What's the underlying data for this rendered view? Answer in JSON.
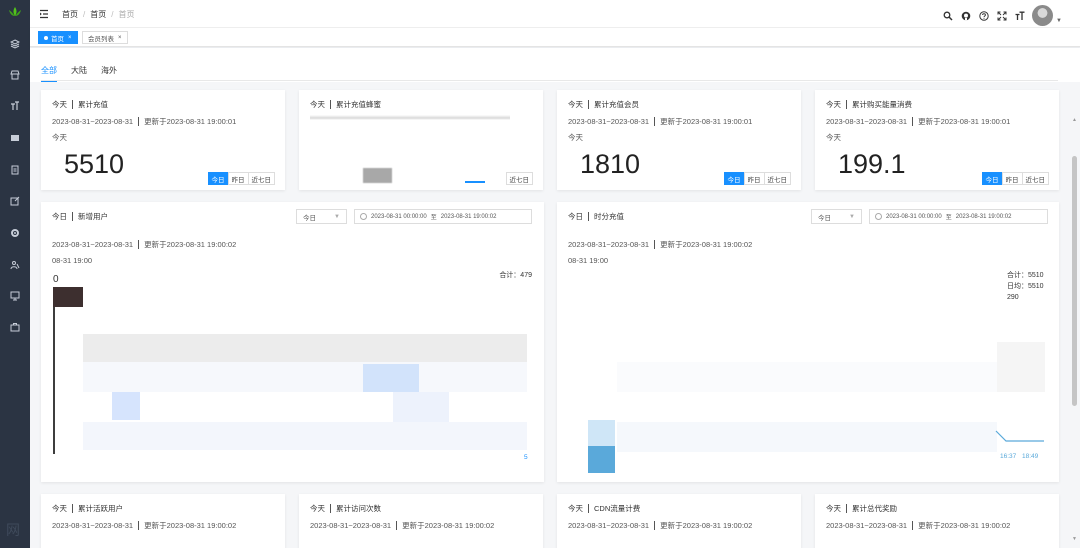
{
  "colors": {
    "primary": "#1890ff",
    "sidebar": "#2b3443"
  },
  "sidebar": {
    "icons": [
      "lotus-logo-icon",
      "layers-icon",
      "shop-icon",
      "text-size-icon",
      "grid-icon",
      "document-icon",
      "edit-icon",
      "gear-icon",
      "users-icon",
      "monitor-icon",
      "briefcase-icon"
    ],
    "bottom_glyph": "网"
  },
  "header": {
    "breadcrumb": [
      "首页",
      "首页",
      "首页"
    ],
    "tools": [
      "search-icon",
      "github-icon",
      "question-icon",
      "fullscreen-icon",
      "font-size-icon"
    ]
  },
  "tags": {
    "active": "首页",
    "second": "会员列表"
  },
  "tabs": [
    "全部",
    "大陆",
    "海外"
  ],
  "segments": [
    "今日",
    "昨日",
    "近七日"
  ],
  "cards_top": [
    {
      "period": "今天",
      "title": "累计充值",
      "range": "2023-08-31~2023-08-31",
      "updated": "更新于2023-08-31 19:00:01",
      "label": "今天",
      "value": "5510"
    },
    {
      "period": "今天",
      "title": "累计充值蜂蜜",
      "range": "",
      "updated": "",
      "label": "",
      "value": "",
      "seg": "近七日"
    },
    {
      "period": "今天",
      "title": "累计充值会员",
      "range": "2023-08-31~2023-08-31",
      "updated": "更新于2023-08-31 19:00:01",
      "label": "今天",
      "value": "1810"
    },
    {
      "period": "今天",
      "title": "累计购买能量消费",
      "range": "2023-08-31~2023-08-31",
      "updated": "更新于2023-08-31 19:00:01",
      "label": "今天",
      "value": "199.1"
    }
  ],
  "chart_left": {
    "period": "今日",
    "title": "新增用户",
    "select": "今日",
    "range_start": "2023-08-31 00:00:00",
    "range_sep": "至",
    "range_end": "2023-08-31 19:00:02",
    "date_range": "2023-08-31~2023-08-31",
    "updated": "更新于2023-08-31 19:00:02",
    "time": "08-31 19:00",
    "sum": "合计：479",
    "axis_top": "0",
    "axis_bottom": "5"
  },
  "chart_right": {
    "period": "今日",
    "title": "时分充值",
    "select": "今日",
    "range_start": "2023-08-31 00:00:00",
    "range_sep": "至",
    "range_end": "2023-08-31 19:00:02",
    "date_range": "2023-08-31~2023-08-31",
    "updated": "更新于2023-08-31 19:00:02",
    "time": "08-31 19:00",
    "sum": "合计：5510",
    "avg": "日均：5510",
    "extra": "290",
    "x_ticks": [
      "16:37",
      "18:49"
    ]
  },
  "cards_bottom": [
    {
      "period": "今天",
      "title": "累计活跃用户",
      "range": "2023-08-31~2023-08-31",
      "updated": "更新于2023-08-31 19:00:02"
    },
    {
      "period": "今天",
      "title": "累计访问次数",
      "range": "2023-08-31~2023-08-31",
      "updated": "更新于2023-08-31 19:00:02"
    },
    {
      "period": "今天",
      "title": "CDN流量计费",
      "range": "2023-08-31~2023-08-31",
      "updated": "更新于2023-08-31 19:00:02"
    },
    {
      "period": "今天",
      "title": "累计总代奖励",
      "range": "2023-08-31~2023-08-31",
      "updated": "更新于2023-08-31 19:00:02"
    }
  ]
}
